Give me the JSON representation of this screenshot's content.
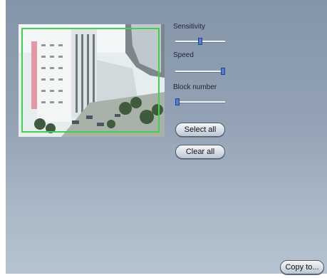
{
  "sliders": {
    "sensitivity": {
      "label": "Sensitivity",
      "value_fraction": 0.5
    },
    "speed": {
      "label": "Speed",
      "value_fraction": 1.0
    },
    "block_number": {
      "label": "Block number",
      "value_fraction": 0.0
    }
  },
  "buttons": {
    "select_all": "Select all",
    "clear_all": "Clear all",
    "copy_to": "Copy to..."
  },
  "colors": {
    "motion_frame": "#3fd24a",
    "slider_thumb": "#4f7fd4"
  }
}
